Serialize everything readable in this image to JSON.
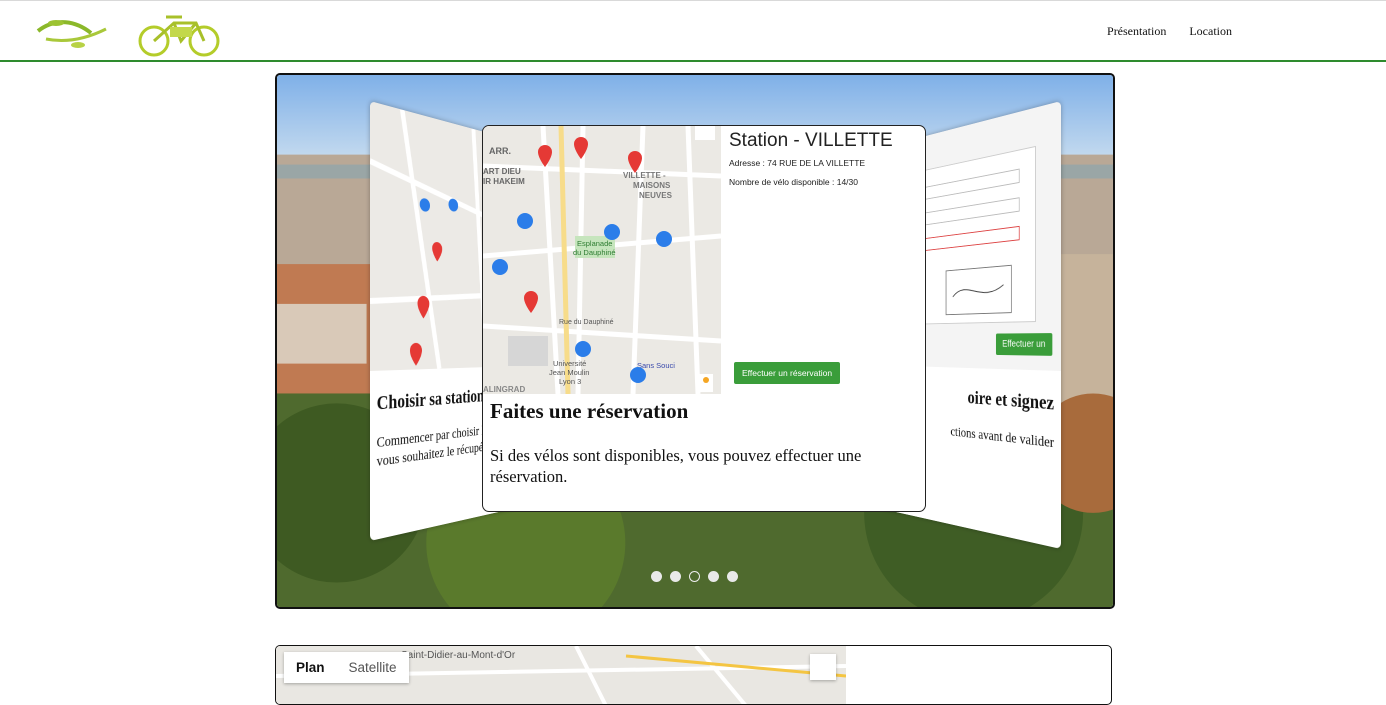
{
  "header": {
    "nav": [
      {
        "label": "Présentation"
      },
      {
        "label": "Location"
      }
    ],
    "accent_color": "#2e8b2e",
    "logo_icon": "bicycle-logo-icon"
  },
  "slider": {
    "active_index": 2,
    "dots_count": 5,
    "slide_left": {
      "title": "Choisir sa station",
      "text": "Commencer par choisir la station où vous souhaitez le récupérer"
    },
    "slide_front": {
      "station_title": "Station - VILLETTE",
      "address": "Adresse : 74 RUE DE LA VILLETTE",
      "bikes": "Nombre de vélo disponible : 14/30",
      "button": "Effectuer un réservation",
      "title": "Faites une réservation",
      "text": "Si des vélos sont disponibles, vous pouvez effectuer une réservation."
    },
    "slide_right": {
      "title": "oire et signez",
      "text": "ctions avant de valider",
      "button": "Effectuer un"
    },
    "map_labels": [
      "ARR.",
      "ART DIEU",
      "IR HAKEIM",
      "VILLETTE -",
      "MAISONS",
      "NEUVES",
      "Esplanade",
      "du Dauphiné",
      "Université",
      "Jean Moulin",
      "Lyon 3",
      "Sans Souci",
      "Rue du Dauphiné",
      "ALINGRAD"
    ]
  },
  "bottom_map": {
    "tab_plan": "Plan",
    "tab_satellite": "Satellite",
    "place": "Saint-Didier-au-Mont-d'Or"
  }
}
